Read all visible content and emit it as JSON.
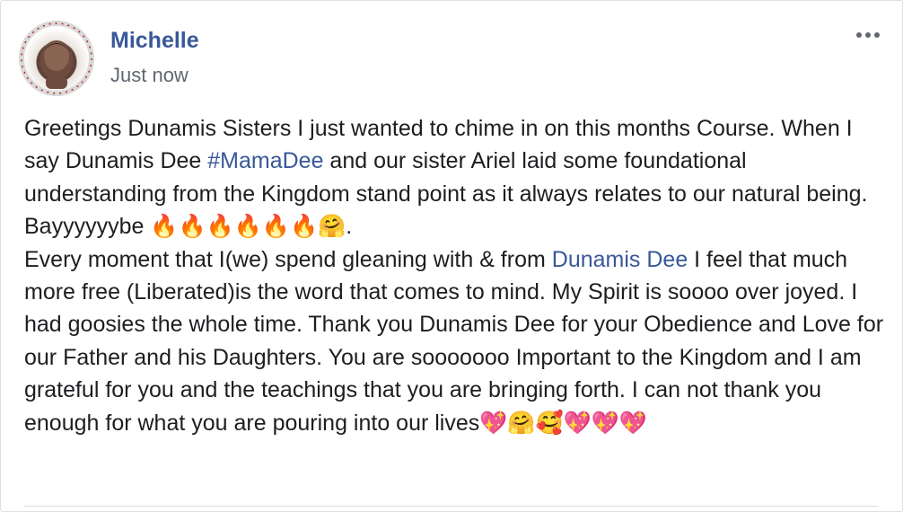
{
  "post": {
    "author": "Michelle",
    "timestamp": "Just now",
    "text_parts": {
      "p1": "Greetings Dunamis Sisters I just wanted to chime in on this months Course. When I say Dunamis Dee ",
      "hashtag": "#MamaDee",
      "p2": " and our sister Ariel laid some foundational understanding from the Kingdom stand point as it always relates to our natural being. Bayyyyyybe 🔥🔥🔥🔥🔥🔥🤗.",
      "p3": "Every moment that I(we) spend gleaning with & from ",
      "mention": "Dunamis Dee",
      "p4": " I feel that much more free (Liberated)is the word that comes to mind. My Spirit is soooo over joyed. I had goosies the whole time. Thank you Dunamis Dee for your Obedience and Love for our Father and his Daughters. You are sooooooo Important to the Kingdom and I am grateful for you and the teachings that you are bringing forth. I can not thank you enough for what you are pouring into our lives💖🤗🥰💖💖💖"
    }
  },
  "icons": {
    "avatar": "profile-photo",
    "more": "more-options-icon"
  },
  "colors": {
    "link": "#385898",
    "text": "#1c1e21",
    "muted": "#606770"
  }
}
